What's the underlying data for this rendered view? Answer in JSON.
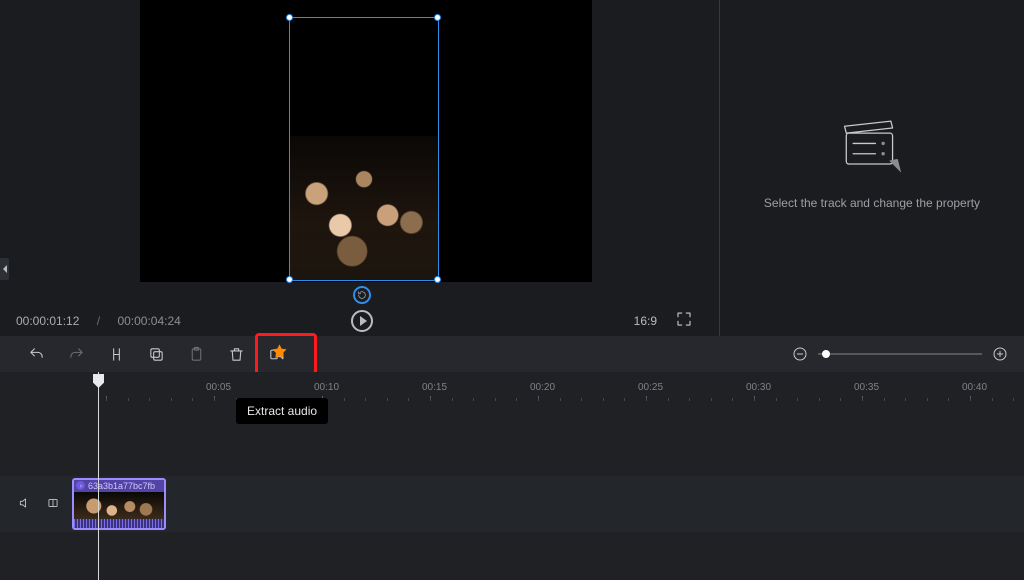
{
  "preview": {
    "current_time": "00:00:01:12",
    "separator": "/",
    "duration": "00:00:04:24",
    "aspect_ratio": "16:9"
  },
  "props_panel": {
    "hint": "Select the track and change the property"
  },
  "toolbar": {
    "tooltip_extract_audio": "Extract audio"
  },
  "timeline": {
    "ticks": [
      "00:05",
      "00:10",
      "00:15",
      "00:20",
      "00:25",
      "00:30",
      "00:35",
      "00:40"
    ],
    "clip_title": "63a3b1a77bc7fb"
  }
}
